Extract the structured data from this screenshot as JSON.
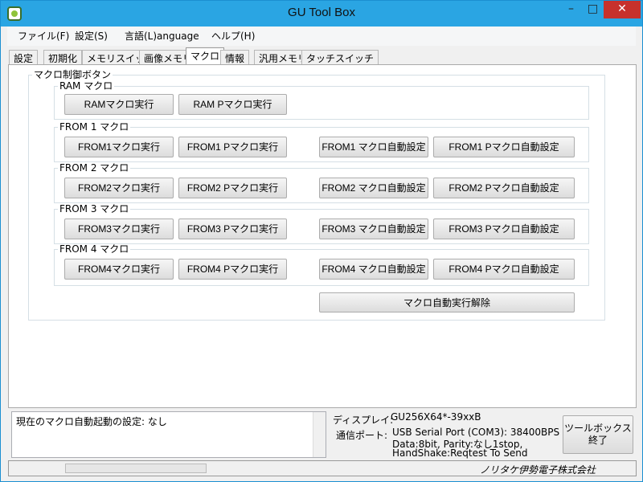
{
  "window": {
    "title": "GU Tool Box",
    "minimize": "–",
    "maximize": "□",
    "close": "✕"
  },
  "menu": [
    "ファイル(F)",
    "設定(S)",
    "言語(L)anguage",
    "ヘルプ(H)"
  ],
  "tabs": [
    "設定",
    "初期化",
    "メモリスイッチ",
    "画像メモリ",
    "マクロ",
    "情報",
    "汎用メモリ",
    "タッチスイッチ"
  ],
  "active_tab": "マクロ",
  "macro": {
    "group_title": "マクロ制御ボタン",
    "ram": {
      "title": "RAM マクロ",
      "run": "RAMマクロ実行",
      "p_run": "RAM Pマクロ実行"
    },
    "from1": {
      "title": "FROM 1 マクロ",
      "run": "FROM1マクロ実行",
      "p_run": "FROM1 Pマクロ実行",
      "auto": "FROM1 マクロ自動設定",
      "p_auto": "FROM1 Pマクロ自動設定"
    },
    "from2": {
      "title": "FROM 2 マクロ",
      "run": "FROM2マクロ実行",
      "p_run": "FROM2 Pマクロ実行",
      "auto": "FROM2 マクロ自動設定",
      "p_auto": "FROM2 Pマクロ自動設定"
    },
    "from3": {
      "title": "FROM 3 マクロ",
      "run": "FROM3マクロ実行",
      "p_run": "FROM3 Pマクロ実行",
      "auto": "FROM3 マクロ自動設定",
      "p_auto": "FROM3 Pマクロ自動設定"
    },
    "from4": {
      "title": "FROM 4 マクロ",
      "run": "FROM4マクロ実行",
      "p_run": "FROM4 Pマクロ実行",
      "auto": "FROM4 マクロ自動設定",
      "p_auto": "FROM4 Pマクロ自動設定"
    },
    "cancel_auto": "マクロ自動実行解除"
  },
  "status": {
    "text": "現在のマクロ自動起動の設定: なし"
  },
  "info": {
    "display_label": "ディスプレイ:",
    "display_value": "GU256X64*-39xxB",
    "comm_label": "通信ポート:",
    "comm_line1": "USB Serial Port (COM3):  38400BPS",
    "comm_line2": "Data:8bit, Parity:なし1stop,",
    "comm_line3": "HandShake:Reqtest To Send"
  },
  "exit_button": {
    "line1": "ツールボックス",
    "line2": "終了"
  },
  "company": "ノリタケ伊勢電子株式会社"
}
